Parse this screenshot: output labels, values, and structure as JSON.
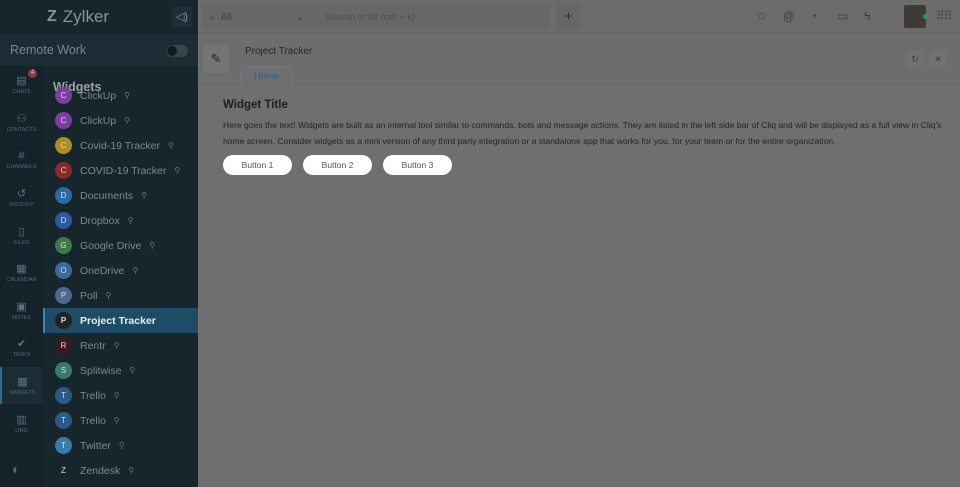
{
  "brand": {
    "name": "Zylker",
    "logo": "Z"
  },
  "org": {
    "name": "Remote Work",
    "toggle_on": false
  },
  "rail": [
    {
      "label": "CHATS",
      "icon": "chat-icon",
      "glyph": "▤",
      "badge": "4"
    },
    {
      "label": "CONTACTS",
      "icon": "contact-icon",
      "glyph": "⚇"
    },
    {
      "label": "CHANNELS",
      "icon": "hash-icon",
      "glyph": "#"
    },
    {
      "label": "HISTORY",
      "icon": "history-icon",
      "glyph": "↺"
    },
    {
      "label": "FILES",
      "icon": "file-icon",
      "glyph": "▯"
    },
    {
      "label": "CALENDAR",
      "icon": "calendar-icon",
      "glyph": "▦"
    },
    {
      "label": "NOTES",
      "icon": "notes-icon",
      "glyph": "▣"
    },
    {
      "label": "TASKS",
      "icon": "tasks-icon",
      "glyph": "✔"
    },
    {
      "label": "WIDGETS",
      "icon": "widgets-icon",
      "glyph": "▦",
      "active": true
    },
    {
      "label": "ORG",
      "icon": "org-icon",
      "glyph": "▥"
    }
  ],
  "widgets": {
    "title": "Widgets",
    "items": [
      {
        "label": "ClickUp",
        "color": "#7a3fa0"
      },
      {
        "label": "ClickUp",
        "color": "#7a3fa0"
      },
      {
        "label": "Covid-19 Tracker",
        "color": "#b08b20"
      },
      {
        "label": "COVID-19 Tracker",
        "color": "#8a2a2a"
      },
      {
        "label": "Documents",
        "color": "#2a6aa0"
      },
      {
        "label": "Dropbox",
        "color": "#2a5aa0"
      },
      {
        "label": "Google Drive",
        "color": "#3a7a4a"
      },
      {
        "label": "OneDrive",
        "color": "#3a6a9a"
      },
      {
        "label": "Poll",
        "color": "#4a6a90"
      },
      {
        "label": "Project Tracker",
        "color": "#222222",
        "active": true
      },
      {
        "label": "Rentr",
        "color": "#3a1a20"
      },
      {
        "label": "Splitwise",
        "color": "#3a7a6a"
      },
      {
        "label": "Trello",
        "color": "#2a5a8a"
      },
      {
        "label": "Trello",
        "color": "#2a5a8a"
      },
      {
        "label": "Twitter",
        "color": "#3a7aa8"
      },
      {
        "label": "Zendesk",
        "color": "#17252d"
      }
    ]
  },
  "topbar": {
    "scope": "All",
    "search_placeholder": "Search in All (ctrl + k)"
  },
  "widget": {
    "name": "Project Tracker",
    "tab": "Home",
    "title": "Widget Title",
    "text": "Here goes the text! Widgets are built as an internal tool similar to commands, bots and message actions. They are listed in the left side bar of Cliq and will be displayed as a full view in Cliq's home screen. Consider widgets as a mini version of any third party integration or a standalone app that works for you, for your team or for the entire organization.",
    "buttons": [
      "Button 1",
      "Button 2",
      "Button 3"
    ]
  }
}
